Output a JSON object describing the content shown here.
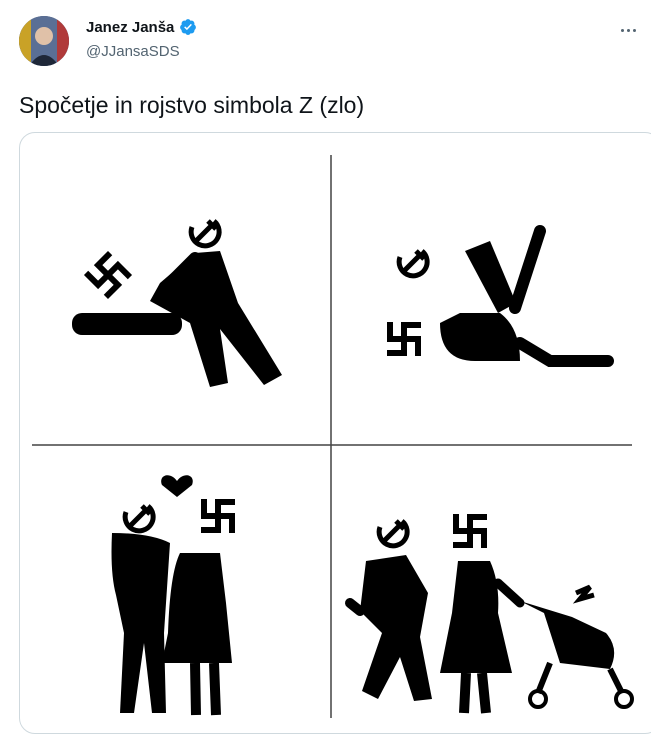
{
  "author": {
    "display_name": "Janez Janša",
    "handle": "@JJansaSDS",
    "verified": true,
    "avatar_icon": "profile-photo"
  },
  "tweet": {
    "text": "Spočetje in rojstvo simbola Z (zlo)"
  },
  "media": {
    "type": "image",
    "description_icons": [
      "swastika-icon",
      "hammer-sickle-icon",
      "heart-icon",
      "stroller-icon"
    ]
  },
  "colors": {
    "verified": "#1d9bf0",
    "text": "#0f1419",
    "secondary": "#536471",
    "border": "#cfd9de"
  }
}
